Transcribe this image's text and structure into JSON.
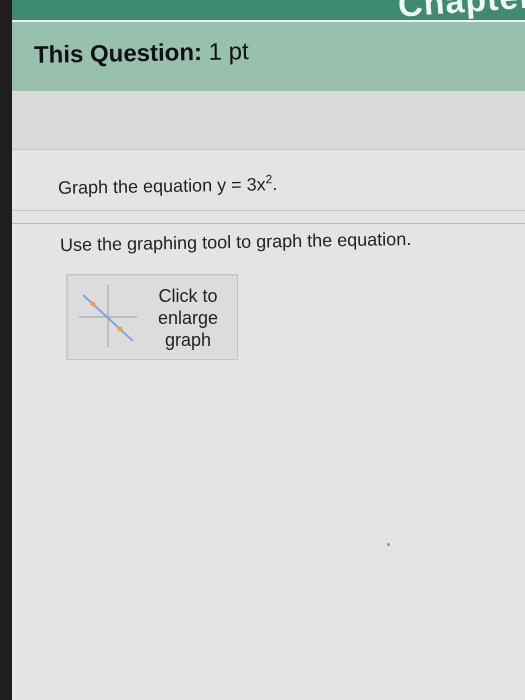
{
  "banner": {
    "title": "Chapter"
  },
  "question_header": {
    "title": "This Question:",
    "points": "1 pt"
  },
  "question": {
    "prompt_prefix": "Graph the equation y = 3x",
    "prompt_superscript": "2",
    "prompt_suffix": ".",
    "instruction": "Use the graphing tool to graph the equation."
  },
  "graph_button": {
    "line1": "Click to",
    "line2": "enlarge",
    "line3": "graph"
  },
  "icons": {
    "graph_thumbnail": "line-graph-icon"
  },
  "colors": {
    "banner": "#3f8a73",
    "header": "#97c1ae",
    "background": "#e4e4e4",
    "thumbnail_line": "#7ea6d9",
    "thumbnail_points": "#f0a23a"
  }
}
